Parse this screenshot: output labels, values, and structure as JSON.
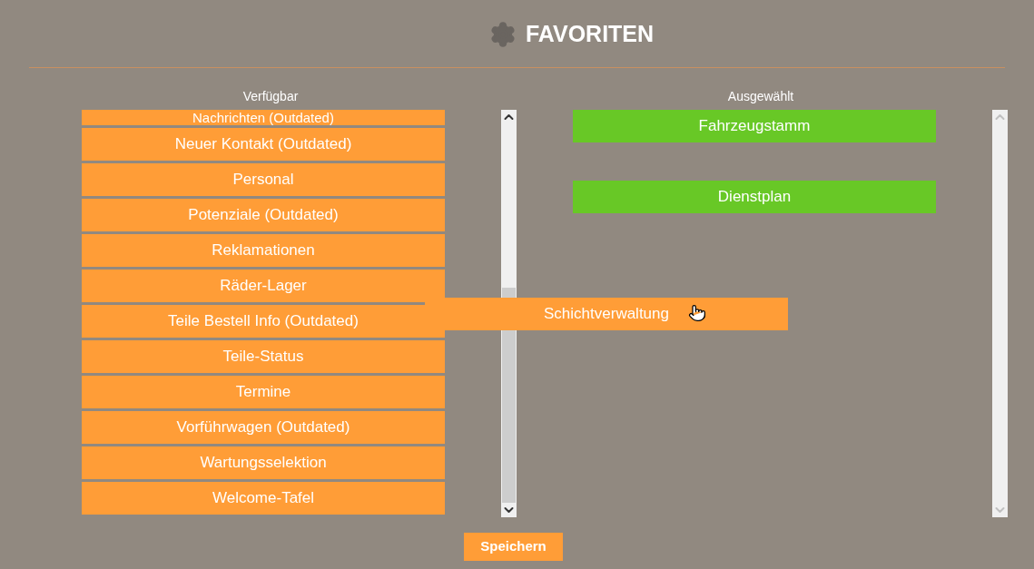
{
  "title": "FAVORITEN",
  "available": {
    "label": "Verfügbar",
    "items": [
      "Nachrichten (Outdated)",
      "Neuer Kontakt (Outdated)",
      "Personal",
      "Potenziale (Outdated)",
      "Reklamationen",
      "Räder-Lager",
      "Teile Bestell Info (Outdated)",
      "Teile-Status",
      "Termine",
      "Vorführwagen (Outdated)",
      "Wartungsselektion",
      "Welcome-Tafel"
    ]
  },
  "selected": {
    "label": "Ausgewählt",
    "items": [
      "Fahrzeugstamm",
      "Dienstplan"
    ]
  },
  "dragging": {
    "label": "Schichtverwaltung"
  },
  "save_button": "Speichern"
}
